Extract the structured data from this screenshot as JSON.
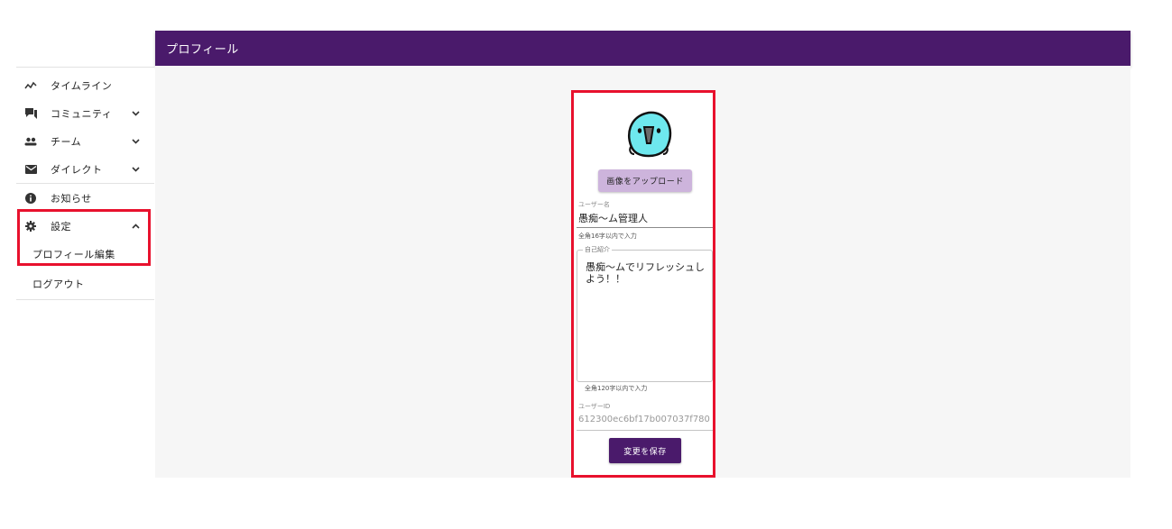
{
  "header": {
    "title": "プロフィール"
  },
  "sidebar": {
    "items": [
      {
        "label": "タイムライン",
        "icon": "timeline-icon"
      },
      {
        "label": "コミュニティ",
        "icon": "forum-icon",
        "expand": "chevron-down-icon"
      },
      {
        "label": "チーム",
        "icon": "group-icon",
        "expand": "chevron-down-icon"
      },
      {
        "label": "ダイレクト",
        "icon": "mail-icon",
        "expand": "chevron-down-icon"
      },
      {
        "label": "お知らせ",
        "icon": "info-icon"
      },
      {
        "label": "設定",
        "icon": "gear-icon",
        "expand": "chevron-up-icon"
      }
    ],
    "settings_sub": {
      "label": "プロフィール編集"
    },
    "logout": {
      "label": "ログアウト"
    }
  },
  "profile": {
    "upload_label": "画像をアップロード",
    "username_label": "ユーザー名",
    "username_value": "愚痴〜ム管理人",
    "username_helper": "全角16字以内で入力",
    "bio_label": "自己紹介",
    "bio_value": "愚痴〜ムでリフレッシュしよう！！",
    "bio_helper": "全角120字以内で入力",
    "userid_label": "ユーザーID",
    "userid_value": "612300ec6bf17b007037f780",
    "save_label": "変更を保存"
  },
  "colors": {
    "brand": "#4a1a6b",
    "upload_button": "#cdb4dc",
    "highlight": "#e8112d"
  }
}
